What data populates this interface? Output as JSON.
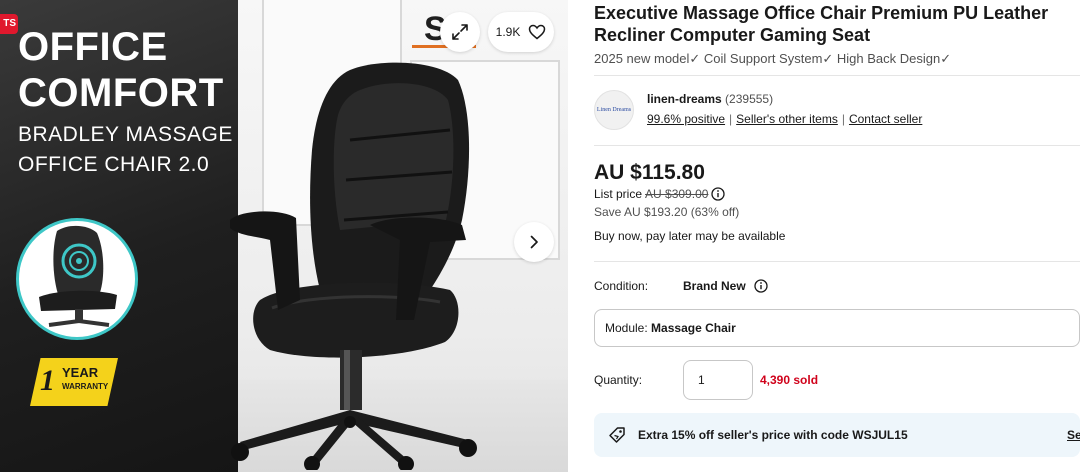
{
  "gallery": {
    "corner_badge": "TS",
    "promo_title_line1": "OFFICE",
    "promo_title_line2": "COMFORT",
    "promo_sub_line1": "BRADLEY MASSAGE",
    "promo_sub_line2": "OFFICE CHAIR 2.0",
    "warranty_number": "1",
    "warranty_year": "YEAR",
    "warranty_label": "WARRANTY",
    "logo_fragment": "S",
    "watch_count": "1.9K",
    "icons": {
      "expand": "expand-icon",
      "watch": "heart-icon",
      "next": "chevron-right-icon"
    },
    "colors": {
      "panel_dark": "#1f1f1f",
      "thumb_ring": "#3ec7c7",
      "warranty_yellow": "#f4d21b",
      "badge_red": "#e0182d"
    }
  },
  "listing": {
    "title": "Executive Massage Office Chair Premium PU Leather Recliner Computer Gaming Seat",
    "subtitle": "2025 new model✓ Coil Support System✓ High Back Design✓"
  },
  "seller": {
    "logo_text": "Linen Dreams",
    "name": "linen-dreams",
    "feedback_count": "(239555)",
    "positive": "99.6% positive",
    "other_items": "Seller's other items",
    "contact": "Contact seller"
  },
  "pricing": {
    "price": "AU $115.80",
    "list_price_label": "List price",
    "list_price": "AU $309.00",
    "save": "Save AU $193.20 (63% off)",
    "bnpl": "Buy now, pay later may be available"
  },
  "condition": {
    "label": "Condition:",
    "value": "Brand New",
    "info_icon": "info-icon"
  },
  "module": {
    "label": "Module:",
    "value": "Massage Chair"
  },
  "quantity": {
    "label": "Quantity:",
    "value": "1",
    "sold": "4,390 sold"
  },
  "coupon": {
    "icon": "tag-icon",
    "text_prefix": "Extra 15% off seller's price with code ",
    "code": "WSJUL15",
    "link": "Se"
  }
}
